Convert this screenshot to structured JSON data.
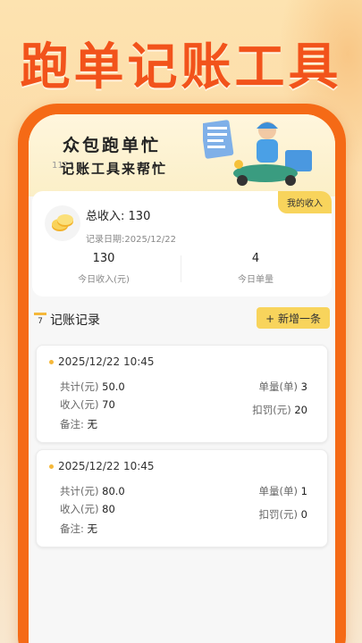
{
  "promo": {
    "title": "跑单记账工具"
  },
  "banner": {
    "title": "众包跑单忙",
    "subtitle": "记账工具来帮忙",
    "subtitle_faded": "1121"
  },
  "income": {
    "badge": "我的收入",
    "total_label": "总收入:",
    "total_value": "130",
    "date_label": "记录日期:",
    "date_value": "2025/12/22",
    "today_income_value": "130",
    "today_income_label": "今日收入(元)",
    "today_orders_value": "4",
    "today_orders_label": "今日单量"
  },
  "records_section": {
    "calendar_day": "7",
    "title": "记账记录",
    "add_button": "+ 新增一条"
  },
  "labels": {
    "total": "共计(元)",
    "income": "收入(元)",
    "note": "备注:",
    "orders": "单量(单)",
    "penalty": "扣罚(元)"
  },
  "records": [
    {
      "time": "2025/12/22 10:45",
      "total": "50.0",
      "income": "70",
      "note": "无",
      "orders": "3",
      "penalty": "20"
    },
    {
      "time": "2025/12/22 10:45",
      "total": "80.0",
      "income": "80",
      "note": "无",
      "orders": "1",
      "penalty": "0"
    }
  ],
  "icons": {
    "coin": "coin-icon",
    "calendar": "calendar-icon",
    "rider": "delivery-rider-illustration"
  },
  "colors": {
    "brand": "#f2531b",
    "frame": "#f56a16",
    "accent": "#f8d45c"
  }
}
